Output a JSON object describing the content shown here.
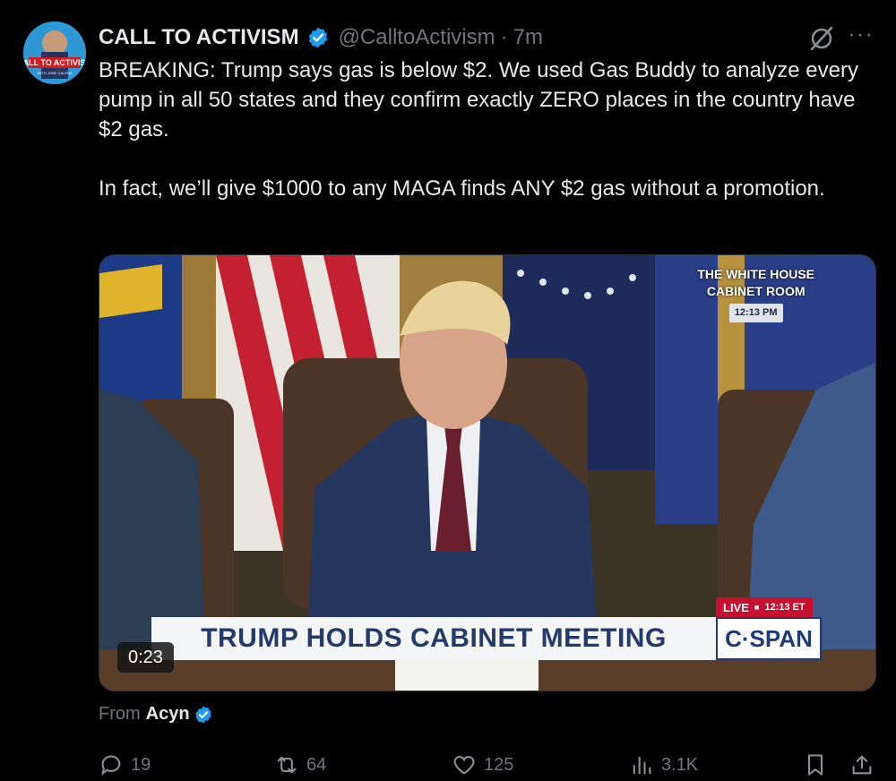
{
  "tweet": {
    "author_name": "CALL TO ACTIVISM",
    "handle": "@CalltoActivism",
    "separator": "·",
    "time": "7m",
    "more": "···",
    "avatar_text_top": "CALL TO ACTIVISM",
    "avatar_text_bottom": "WITH JOSE GALENA",
    "paragraph1": "BREAKING: Trump says gas is below $2. We used Gas Buddy to analyze every pump in all 50 states and they confirm exactly ZERO places in the country have $2 gas.",
    "paragraph2": "In fact, we’ll give $1000 to any MAGA finds ANY $2 gas without a promotion.",
    "from_label": "From",
    "from_name": "Acyn"
  },
  "video": {
    "location_line1": "THE WHITE HOUSE",
    "location_line2": "CABINET ROOM",
    "location_time": "12:13 PM",
    "live_label": "LIVE",
    "live_time": "12:13 ET",
    "banner": "TRUMP HOLDS CABINET MEETING",
    "network": "C·SPAN",
    "duration": "0:23"
  },
  "actions": {
    "replies": "19",
    "reposts": "64",
    "likes": "125",
    "views": "3.1K"
  },
  "colors": {
    "background": "#000000",
    "text": "#e7e9ea",
    "muted": "#71767b",
    "verified": "#1d9bf0",
    "banner_text": "#233a6b",
    "live_red": "#c8102e"
  },
  "icons": [
    "verified-badge-icon",
    "grok-icon",
    "more-icon",
    "reply-icon",
    "repost-icon",
    "like-icon",
    "views-icon",
    "bookmark-icon",
    "share-icon"
  ]
}
